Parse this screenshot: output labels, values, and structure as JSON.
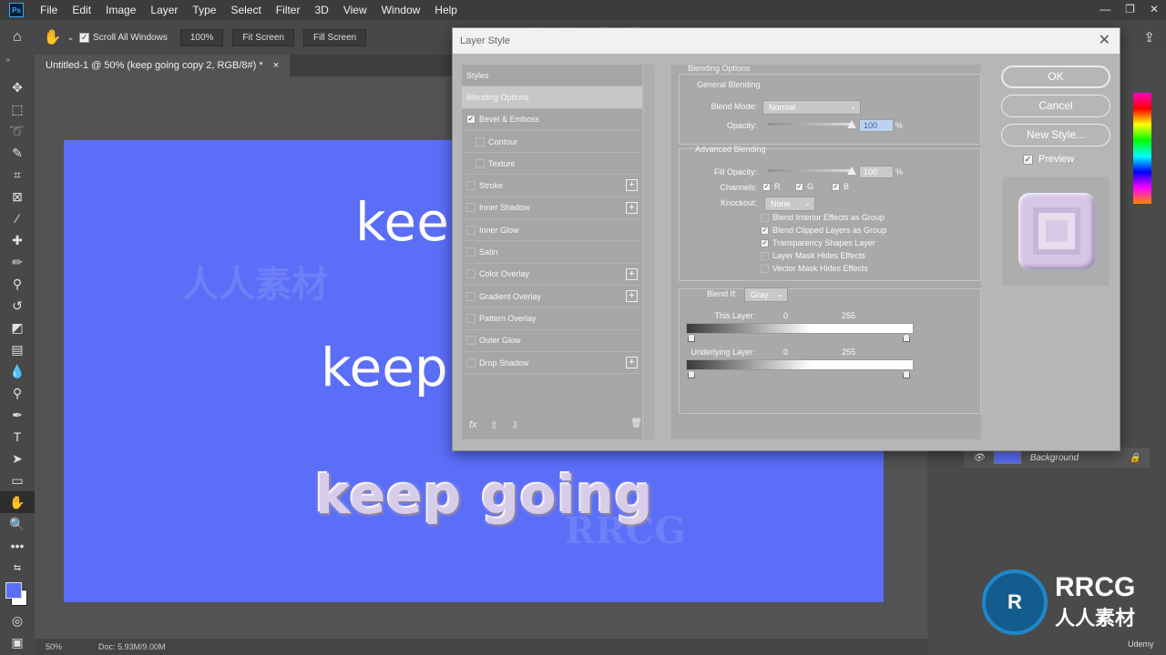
{
  "app": {
    "logo": "Ps",
    "menu": [
      "File",
      "Edit",
      "Image",
      "Layer",
      "Type",
      "Select",
      "Filter",
      "3D",
      "View",
      "Window",
      "Help"
    ]
  },
  "options_bar": {
    "scroll_all_windows": "Scroll All Windows",
    "zoom": "100%",
    "fit_screen": "Fit Screen",
    "fill_screen": "Fill Screen"
  },
  "document": {
    "tab_title": "Untitled-1 @ 50% (keep going copy 2, RGB/8#) *",
    "tab_close": "×",
    "canvas_color": "#5a6ef8",
    "text_layers": [
      "keep",
      "keep",
      "keep going"
    ]
  },
  "status_bar": {
    "zoom": "50%",
    "doc_size": "Doc: 5.93M/9.00M"
  },
  "layers_panel": {
    "background_layer": "Background"
  },
  "dialog": {
    "title": "Layer Style",
    "styles_header": "Styles",
    "styles": [
      {
        "label": "Blending Options",
        "checkbox": false,
        "checked": false,
        "plus": false,
        "selected": true
      },
      {
        "label": "Bevel & Emboss",
        "checkbox": true,
        "checked": true,
        "plus": false
      },
      {
        "label": "Contour",
        "checkbox": true,
        "checked": false,
        "plus": false,
        "indent": true
      },
      {
        "label": "Texture",
        "checkbox": true,
        "checked": false,
        "plus": false,
        "indent": true
      },
      {
        "label": "Stroke",
        "checkbox": true,
        "checked": false,
        "plus": true
      },
      {
        "label": "Inner Shadow",
        "checkbox": true,
        "checked": false,
        "plus": true
      },
      {
        "label": "Inner Glow",
        "checkbox": true,
        "checked": false,
        "plus": false
      },
      {
        "label": "Satin",
        "checkbox": true,
        "checked": false,
        "plus": false
      },
      {
        "label": "Color Overlay",
        "checkbox": true,
        "checked": false,
        "plus": true
      },
      {
        "label": "Gradient Overlay",
        "checkbox": true,
        "checked": false,
        "plus": true
      },
      {
        "label": "Pattern Overlay",
        "checkbox": true,
        "checked": false,
        "plus": false
      },
      {
        "label": "Outer Glow",
        "checkbox": true,
        "checked": false,
        "plus": false
      },
      {
        "label": "Drop Shadow",
        "checkbox": true,
        "checked": false,
        "plus": true
      }
    ],
    "footer": {
      "fx": "fx",
      "up": "⇧",
      "down": "⇩",
      "trash": "🗑"
    },
    "blending": {
      "section_title": "Blending Options",
      "general_title": "General Blending",
      "blend_mode_label": "Blend Mode:",
      "blend_mode_value": "Normal",
      "opacity_label": "Opacity:",
      "opacity_value": "100",
      "opacity_unit": "%",
      "opacity_level": 1.0,
      "advanced_title": "Advanced Blending",
      "fill_opacity_label": "Fill Opacity:",
      "fill_opacity_value": "100",
      "fill_opacity_unit": "%",
      "fill_opacity_level": 1.0,
      "channels_label": "Channels:",
      "channels": [
        "R",
        "G",
        "B"
      ],
      "knockout_label": "Knockout:",
      "knockout_value": "None",
      "options": [
        {
          "label": "Blend Interior Effects as Group",
          "checked": false
        },
        {
          "label": "Blend Clipped Layers as Group",
          "checked": true
        },
        {
          "label": "Transparency Shapes Layer",
          "checked": true
        },
        {
          "label": "Layer Mask Hides Effects",
          "checked": false
        },
        {
          "label": "Vector Mask Hides Effects",
          "checked": false
        }
      ],
      "blend_if_label": "Blend If:",
      "blend_if_value": "Gray",
      "this_layer_label": "This Layer:",
      "this_layer_min": "0",
      "this_layer_max": "255",
      "underlying_label": "Underlying Layer:",
      "underlying_min": "0",
      "underlying_max": "255"
    },
    "buttons": {
      "ok": "OK",
      "cancel": "Cancel",
      "new_style": "New Style...",
      "preview": "Preview"
    }
  },
  "watermarks": {
    "brand": "RRCG",
    "cn": "人人素材",
    "udemy": "Udemy"
  }
}
